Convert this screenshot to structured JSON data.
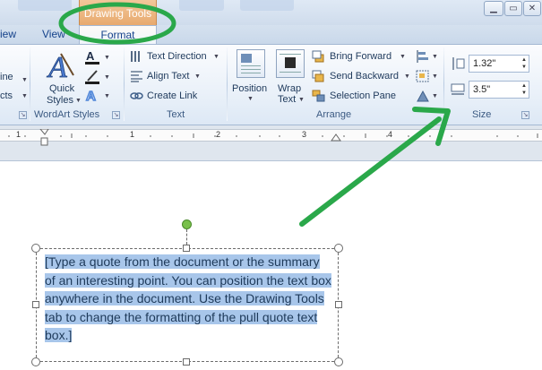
{
  "title_bar": {
    "context_group_label": "Drawing Tools"
  },
  "tabs": {
    "view_partial": "iew",
    "view": "View",
    "format": "Format"
  },
  "ribbon": {
    "partial_group": {
      "line1": "ine",
      "line2": "cts"
    },
    "wordart_styles": {
      "quick_styles_line1": "Quick",
      "quick_styles_line2": "Styles",
      "label": "WordArt Styles"
    },
    "text": {
      "text_direction": "Text Direction",
      "align_text": "Align Text",
      "create_link": "Create Link",
      "label": "Text"
    },
    "arrange": {
      "position": "Position",
      "wrap_text_line1": "Wrap",
      "wrap_text_line2": "Text",
      "bring_forward": "Bring Forward",
      "send_backward": "Send Backward",
      "selection_pane": "Selection Pane",
      "label": "Arrange"
    },
    "size": {
      "height": "1.32\"",
      "width": "3.5\"",
      "label": "Size"
    }
  },
  "ruler": {
    "numbers": [
      "1",
      "1",
      "2",
      "3",
      "4"
    ]
  },
  "document": {
    "quote_text": "[Type a quote from the document or the summary of an interesting point. You can position the text box anywhere in the document. Use the Drawing Tools tab to change the formatting of the pull quote text box.]",
    "quote_lines": [
      "[Type a quote from the document or the summary",
      "of an interesting point. You can position the text box",
      "anywhere in the document. Use the Drawing Tools",
      "tab to change the formatting of the pull quote text",
      "box.]"
    ]
  },
  "annotation": {
    "circle_color": "#2aa84a",
    "arrow_color": "#2aa84a"
  },
  "icons": [
    "text-fill-icon",
    "text-outline-icon",
    "text-effects-icon",
    "text-direction-icon",
    "align-text-icon",
    "create-link-icon",
    "position-icon",
    "wrap-text-icon",
    "bring-forward-icon",
    "send-backward-icon",
    "selection-pane-icon",
    "align-icon",
    "group-icon",
    "rotate-icon",
    "shape-height-icon",
    "shape-width-icon"
  ]
}
